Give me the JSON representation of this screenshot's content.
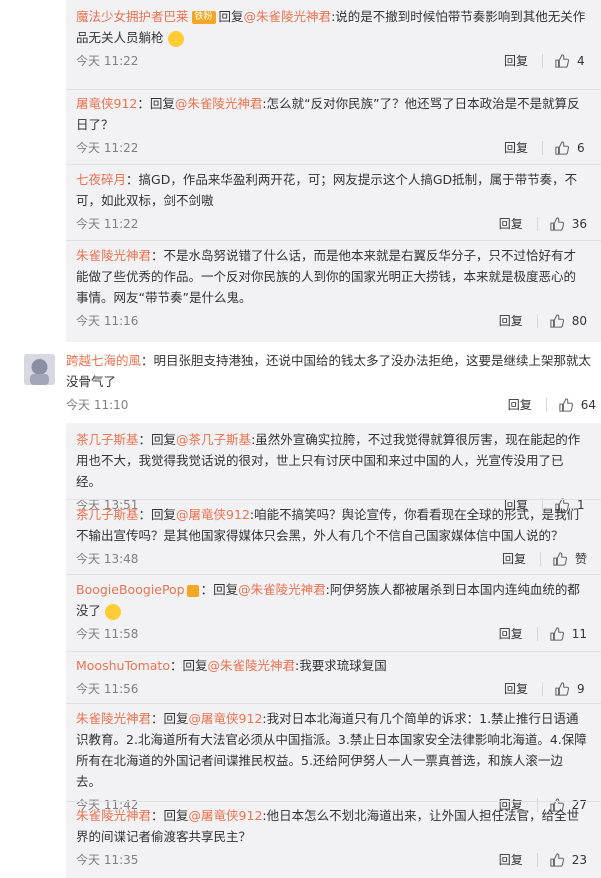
{
  "reply_label": "回复",
  "group1": {
    "replies": [
      {
        "user": "魔法少女拥护者巴莱",
        "badge": "铁粉",
        "reply_to": "回复",
        "mention": "@朱雀陵光神君",
        "text": ":说的是不撤到时候怕带节奏影响到其他无关作品无关人员躺枪",
        "time": "今天 11:22",
        "likes": "4"
      },
      {
        "user": "屠竜侠912",
        "reply_to": "回复",
        "mention": "@朱雀陵光神君",
        "text": ":怎么就“反对你民族”了？他还骂了日本政治是不是就算反日了？",
        "time": "今天 11:22",
        "likes": "6"
      },
      {
        "user": "七夜碎月",
        "text": "：搞GD，作品来华盈利两开花，可；网友提示这个人搞GD抵制，属于带节奏，不可，如此双标，剑不剑嗷",
        "time": "今天 11:22",
        "likes": "36"
      },
      {
        "user": "朱雀陵光神君",
        "text": "：不是水岛努说错了什么话，而是他本来就是右翼反华分子，只不过恰好有才能做了些优秀的作品。一个反对你民族的人到你的国家光明正大捞钱，本来就是极度恶心的事情。网友“带节奏”是什么鬼。",
        "time": "今天 11:16",
        "likes": "80"
      }
    ]
  },
  "top_comment": {
    "user": "跨越七海的風",
    "text": "：明目张胆支持港独，还说中国给的钱太多了没办法拒绝，这要是继续上架那就太没骨气了",
    "time": "今天 11:10",
    "likes": "64"
  },
  "group2": {
    "replies": [
      {
        "user": "茶几子斯基",
        "reply_to": "回复",
        "mention": "@茶几子斯基",
        "text": ":虽然外宣确实拉胯，不过我觉得就算很厉害，现在能起的作用也不大，我觉得我觉话说的很对，世上只有讨厌中国和来过中国的人，光宣传没用了已经。",
        "time": "今天 13:51",
        "likes": "1"
      },
      {
        "user": "茶几子斯基",
        "reply_to": "回复",
        "mention": "@屠竜侠912",
        "text": ":咱能不搞笑吗？舆论宣传，你看看现在全球的形式，是我们不输出宣传吗？是其他国家得媒体只会黑，外人有几个不信自己国家媒体信中国人说的？",
        "time": "今天 13:48",
        "likes": "赞"
      },
      {
        "user": "BoogieBoogiePop",
        "reply_to": "回复",
        "mention": "@朱雀陵光神君",
        "text": ":阿伊努族人都被屠杀到日本国内连纯血统的都没了",
        "time": "今天 11:58",
        "likes": "11"
      },
      {
        "user": "MooshuTomato",
        "reply_to": "回复",
        "mention": "@朱雀陵光神君",
        "text": ":我要求琉球复国",
        "time": "今天 11:56",
        "likes": "9"
      },
      {
        "user": "朱雀陵光神君",
        "reply_to": "回复",
        "mention": "@屠竜侠912",
        "text": ":我对日本北海道只有几个简单的诉求：1.禁止推行日语通识教育。2.北海道所有大法官必须从中国指派。3.禁止日本国家安全法律影响北海道。4.保障所有在北海道的外国记者间谍推民权益。5.还给阿伊努人一人一票真普选，和族人滚一边去。",
        "time": "今天 11:42",
        "likes": "27"
      },
      {
        "user": "朱雀陵光神君",
        "reply_to": "回复",
        "mention": "@屠竜侠912",
        "text": ":他日本怎么不划北海道出来，让外国人担任法官，给全世界的间谍记者偷渡客共享民主？",
        "time": "今天 11:35",
        "likes": "23"
      }
    ]
  },
  "colors": {
    "username": "#eb7350",
    "link": "#eb7350",
    "meta": "#808080",
    "panel": "#f2f2f5"
  }
}
